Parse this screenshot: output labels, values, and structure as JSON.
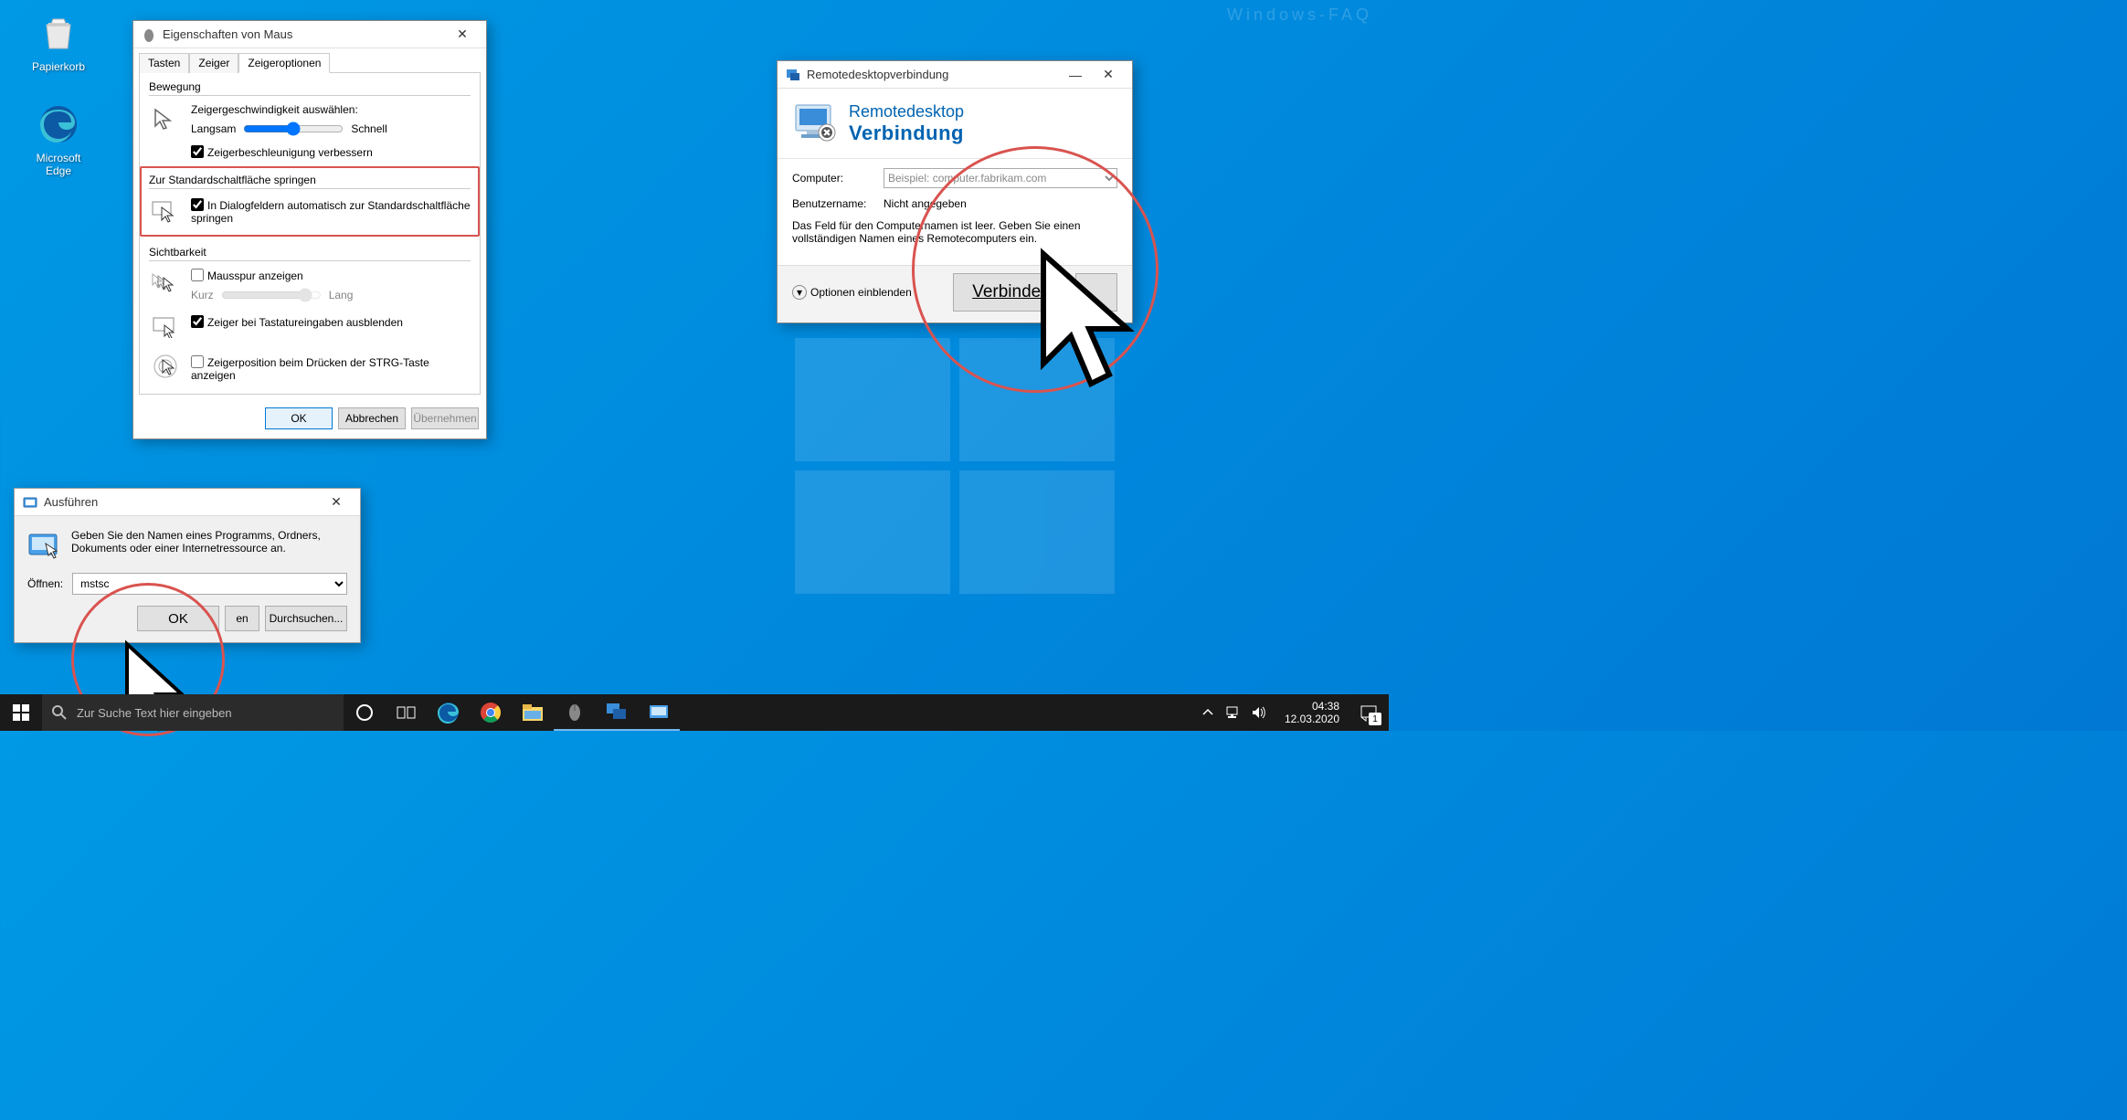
{
  "watermark": "Windows-FAQ",
  "desktop": {
    "recycle_bin": "Papierkorb",
    "edge": "Microsoft Edge"
  },
  "mouse_dialog": {
    "title": "Eigenschaften von Maus",
    "tabs": [
      "Tasten",
      "Zeiger",
      "Zeigeroptionen"
    ],
    "active_tab": 2,
    "group_motion": "Bewegung",
    "speed_label": "Zeigergeschwindigkeit auswählen:",
    "slow": "Langsam",
    "fast": "Schnell",
    "enhance": "Zeigerbeschleunigung verbessern",
    "group_snap": "Zur Standardschaltfläche springen",
    "snap_text": "In Dialogfeldern automatisch zur Standardschaltfläche springen",
    "group_vis": "Sichtbarkeit",
    "trails": "Mausspur anzeigen",
    "trails_short": "Kurz",
    "trails_long": "Lang",
    "hide_typing": "Zeiger bei Tastatureingaben ausblenden",
    "show_ctrl": "Zeigerposition beim Drücken der STRG-Taste anzeigen",
    "ok": "OK",
    "cancel": "Abbrechen",
    "apply": "Übernehmen"
  },
  "run_dialog": {
    "title": "Ausführen",
    "desc": "Geben Sie den Namen eines Programms, Ordners, Dokuments oder einer Internetressource an.",
    "open_label": "Öffnen:",
    "value": "mstsc",
    "ok": "OK",
    "cancel_suffix": "en",
    "browse": "Durchsuchen..."
  },
  "rdp": {
    "wintitle": "Remotedesktopverbindung",
    "head1": "Remotedesktop",
    "head2": "Verbindung",
    "computer_label": "Computer:",
    "computer_placeholder": "Beispiel: computer.fabrikam.com",
    "user_label": "Benutzername:",
    "user_value": "Nicht angegeben",
    "hint": "Das Feld für den Computernamen ist leer. Geben Sie einen vollständigen Namen eines Remotecomputers ein.",
    "options": "Optionen einblenden",
    "connect": "Verbinden"
  },
  "taskbar": {
    "search_placeholder": "Zur Suche Text hier eingeben",
    "time": "04:38",
    "date": "12.03.2020",
    "notif_count": "1"
  }
}
